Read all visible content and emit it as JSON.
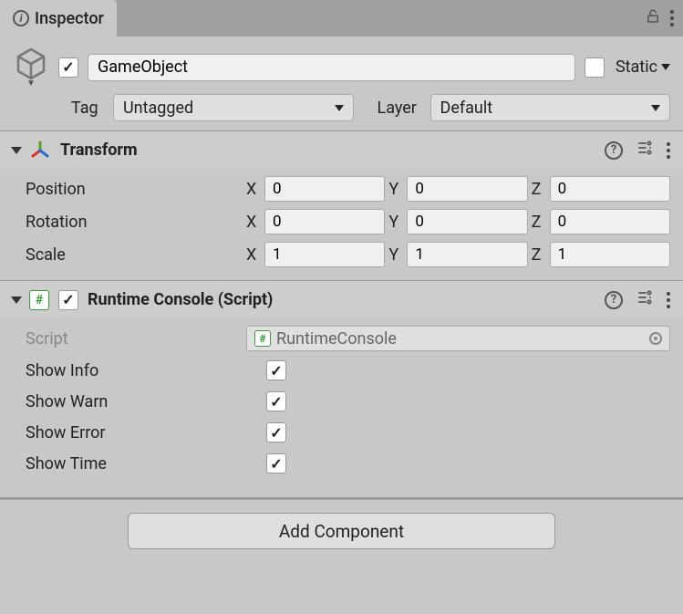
{
  "tab": {
    "title": "Inspector"
  },
  "header": {
    "name": "GameObject",
    "active": true,
    "static_label": "Static",
    "static_checked": false,
    "tag_label": "Tag",
    "tag_value": "Untagged",
    "layer_label": "Layer",
    "layer_value": "Default"
  },
  "transform": {
    "title": "Transform",
    "position": {
      "label": "Position",
      "x": "0",
      "y": "0",
      "z": "0"
    },
    "rotation": {
      "label": "Rotation",
      "x": "0",
      "y": "0",
      "z": "0"
    },
    "scale": {
      "label": "Scale",
      "x": "1",
      "y": "1",
      "z": "1"
    },
    "axis": {
      "x": "X",
      "y": "Y",
      "z": "Z"
    }
  },
  "runtime": {
    "title": "Runtime Console (Script)",
    "enabled": true,
    "script_label": "Script",
    "script_value": "RuntimeConsole",
    "props": {
      "show_info": {
        "label": "Show Info",
        "checked": true
      },
      "show_warn": {
        "label": "Show Warn",
        "checked": true
      },
      "show_error": {
        "label": "Show Error",
        "checked": true
      },
      "show_time": {
        "label": "Show Time",
        "checked": true
      }
    }
  },
  "add_component_label": "Add Component"
}
